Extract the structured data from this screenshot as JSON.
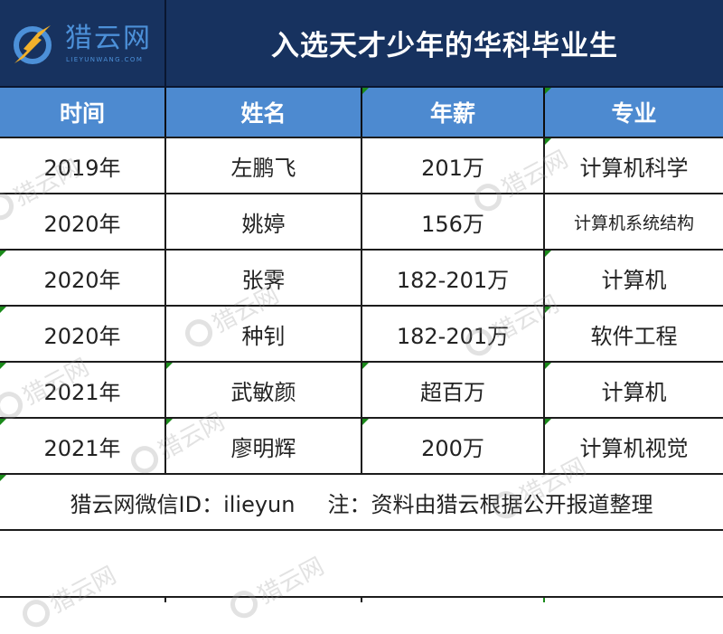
{
  "brand": {
    "name": "猎云网",
    "domain_text": "LIEYUNWANG.COM",
    "logo_icon": "lightning-ring-icon",
    "colors": {
      "ring": "#4c90d8",
      "bolt": "#f2b12b"
    }
  },
  "title": "入选天才少年的华科毕业生",
  "colors": {
    "title_band": "#17325f",
    "header_row": "#4d8ad0",
    "comment_marker": "#1a8a1a"
  },
  "table": {
    "headers": [
      "时间",
      "姓名",
      "年薪",
      "专业"
    ],
    "rows": [
      [
        "2019年",
        "左鹏飞",
        "201万",
        "计算机科学"
      ],
      [
        "2020年",
        "姚婷",
        "156万",
        "计算机系统结构"
      ],
      [
        "2020年",
        "张霁",
        "182-201万",
        "计算机"
      ],
      [
        "2020年",
        "种钊",
        "182-201万",
        "软件工程"
      ],
      [
        "2021年",
        "武敏颜",
        "超百万",
        "计算机"
      ],
      [
        "2021年",
        "廖明辉",
        "200万",
        "计算机视觉"
      ]
    ]
  },
  "footer": {
    "wechat": "猎云网微信ID：ilieyun",
    "note": "注：资料由猎云根据公开报道整理"
  },
  "watermark": "猎云网"
}
